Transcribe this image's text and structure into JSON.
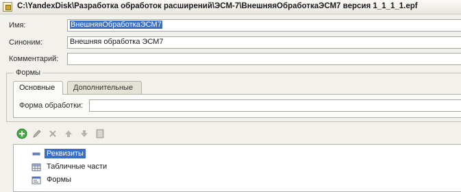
{
  "window": {
    "title": "C:\\YandexDisk\\Разработка обработок расширений\\ЭСМ-7\\ВнешняяОбработкаЭСМ7 версия 1_1_1_1.epf"
  },
  "form": {
    "name_label": "Имя:",
    "name_value": "ВнешняяОбработкаЭСМ7",
    "synonym_label": "Синоним:",
    "synonym_value": "Внешняя обработка ЭСМ7",
    "comment_label": "Комментарий:",
    "comment_value": ""
  },
  "forms_group": {
    "title": "Формы",
    "tabs": [
      {
        "label": "Основные",
        "active": true
      },
      {
        "label": "Дополнительные",
        "active": false
      }
    ],
    "processing_form_label": "Форма обработки:",
    "processing_form_value": ""
  },
  "toolbar": {
    "icons": [
      "add-icon",
      "edit-icon",
      "delete-icon",
      "move-up-icon",
      "move-down-icon",
      "properties-icon"
    ]
  },
  "tree": {
    "items": [
      {
        "label": "Реквизиты",
        "icon": "attribute-icon",
        "selected": true
      },
      {
        "label": "Табличные части",
        "icon": "table-icon",
        "selected": false
      },
      {
        "label": "Формы",
        "icon": "form-icon",
        "selected": false
      }
    ]
  },
  "colors": {
    "selection": "#3a6fc9",
    "background": "#f2f1ec",
    "add_green": "#3da33d"
  }
}
